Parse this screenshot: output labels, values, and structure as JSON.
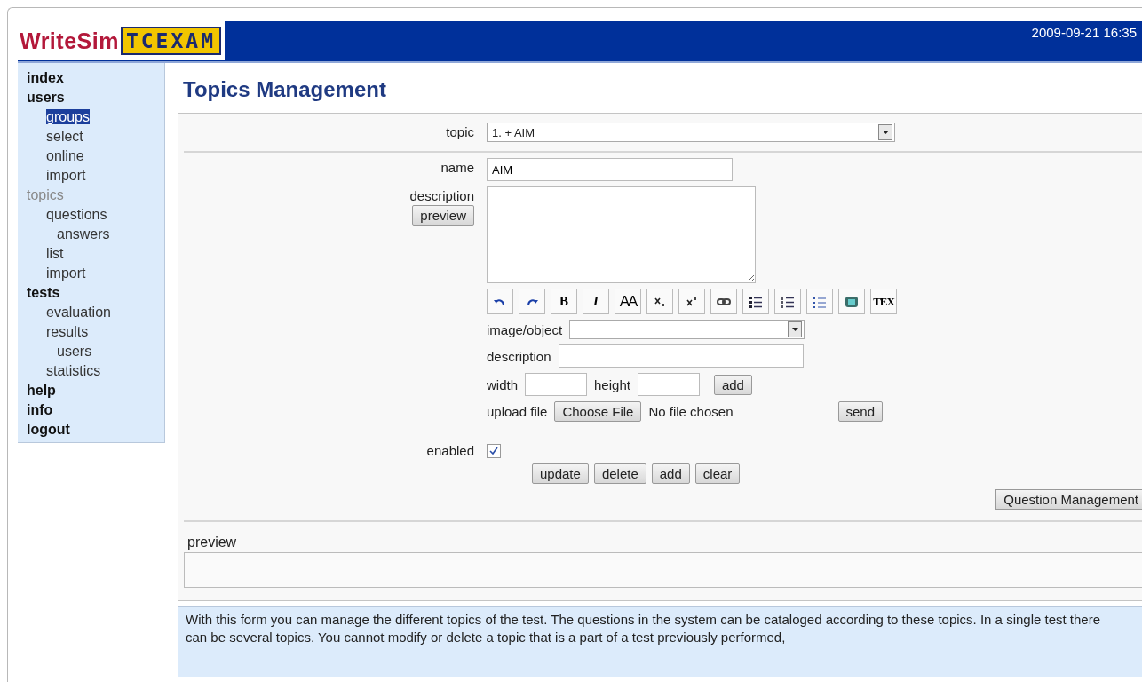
{
  "header": {
    "logo_word": "WriteSim",
    "logo_badge": "TCEXAM",
    "datetime": "2009-09-21 16:35"
  },
  "menu": [
    {
      "label": "index",
      "selected": false,
      "active": false
    },
    {
      "label": "users",
      "selected": false,
      "active": false,
      "children": [
        {
          "label": "groups",
          "selected": true,
          "active": false
        },
        {
          "label": "select",
          "selected": false,
          "active": false
        },
        {
          "label": "online",
          "selected": false,
          "active": false
        },
        {
          "label": "import",
          "selected": false,
          "active": false
        }
      ]
    },
    {
      "label": "topics",
      "selected": false,
      "active": true,
      "children": [
        {
          "label": "questions",
          "selected": false,
          "active": false,
          "children": [
            {
              "label": "answers",
              "selected": false,
              "active": false
            }
          ]
        },
        {
          "label": "list",
          "selected": false,
          "active": false
        },
        {
          "label": "import",
          "selected": false,
          "active": false
        }
      ]
    },
    {
      "label": "tests",
      "selected": false,
      "active": false,
      "children": [
        {
          "label": "evaluation",
          "selected": false,
          "active": false
        },
        {
          "label": "results",
          "selected": false,
          "active": false,
          "children": [
            {
              "label": "users",
              "selected": false,
              "active": false
            }
          ]
        },
        {
          "label": "statistics",
          "selected": false,
          "active": false
        }
      ]
    },
    {
      "label": "help",
      "selected": false,
      "active": false
    },
    {
      "label": "info",
      "selected": false,
      "active": false
    },
    {
      "label": "logout",
      "selected": false,
      "active": false
    }
  ],
  "page_title": "Topics Management",
  "form": {
    "topic": {
      "label": "topic",
      "value": "1. + AIM"
    },
    "name": {
      "label": "name",
      "value": "AIM"
    },
    "description": {
      "label": "description",
      "preview_button": "preview"
    },
    "toolbar": [
      {
        "kind": "undo"
      },
      {
        "kind": "redo"
      },
      {
        "kind": "bold",
        "label": "B"
      },
      {
        "kind": "italic",
        "label": "I"
      },
      {
        "kind": "fontsize",
        "label": "AA"
      },
      {
        "kind": "subscript"
      },
      {
        "kind": "superscript"
      },
      {
        "kind": "link"
      },
      {
        "kind": "bullets"
      },
      {
        "kind": "numbered"
      },
      {
        "kind": "list"
      },
      {
        "kind": "object"
      },
      {
        "kind": "tex",
        "label": "TEX"
      }
    ],
    "image_object": {
      "label": "image/object"
    },
    "image_description": {
      "label": "description"
    },
    "width": {
      "label": "width"
    },
    "height": {
      "label": "height"
    },
    "add_button": "add",
    "upload": {
      "label": "upload file",
      "choose_button": "Choose File",
      "status": "No file chosen",
      "send_button": "send"
    },
    "enabled": {
      "label": "enabled",
      "checked": true
    },
    "actions": [
      "update",
      "delete",
      "add",
      "clear"
    ],
    "question_management_button": "Question Management"
  },
  "preview": {
    "label": "preview"
  },
  "info": "With this form you can manage the different topics of the test. The questions in the system can be cataloged according to these topics. In a single test there can be several topics. You cannot modify or delete a topic that is a part of a test previously performed,"
}
